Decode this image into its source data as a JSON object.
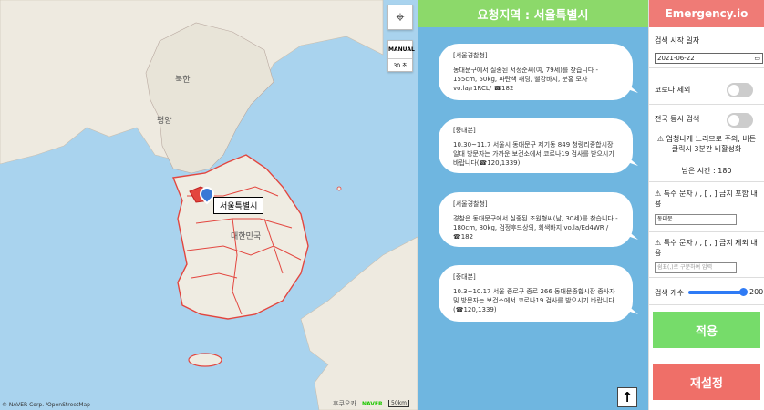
{
  "map": {
    "manual_label": "MANUAL",
    "timer_label": "30 초",
    "places": [
      {
        "name": "북한",
        "id": "north-korea"
      },
      {
        "name": "평양",
        "id": "pyongyang"
      },
      {
        "name": "대한민국",
        "id": "south-korea"
      },
      {
        "name": "후쿠오카",
        "id": "fukuoka"
      }
    ],
    "selected_region": "서울특별시",
    "copyright": "© NAVER Corp. /OpenStreetMap",
    "logo": "NAVER",
    "scale": "50km",
    "border_color": "#e3463f"
  },
  "feed": {
    "title": "요청지역 : 서울특별시",
    "messages": [
      {
        "source": "[서울경찰청]",
        "text": "동대문구에서 실종된 서정순씨(여, 79세)를 찾습니다 - 155cm, 50kg, 파란색 패딩, 빨강바지, 분홍 모자 vo.la/r1RCL/ ☎182"
      },
      {
        "source": "[중대본]",
        "text": "10.30~11.7 서울시 동대문구 제기동 849 청량리종합시장 일대 방문자는 가까운 보건소에서 코로나19 검사를 받으시기 바랍니다(☎120,1339)"
      },
      {
        "source": "[서울경찰청]",
        "text": "경찰은 동대문구에서 실종된 조원형씨(남, 30세)를 찾습니다 - 180cm, 80kg, 검정후드상의, 회색바지 vo.la/Ed4WR / ☎182"
      },
      {
        "source": "[중대본]",
        "text": "10.3~10.17 서울 종로구 종로 266 동대문종합시장 종사자 및 방문자는 보건소에서 코로나19 검사를 받으시기 바랍니다(☎120,1339)"
      }
    ],
    "up_icon": "up-arrow-icon"
  },
  "panel": {
    "title": "Emergency.io",
    "start_date_label": "검색 시작 일자",
    "start_date_value": "2021-06-22",
    "corona_exclude_label": "코로나 제외",
    "corona_exclude_on": false,
    "nationwide_label": "전국 동시 검색",
    "nationwide_on": false,
    "warning": "⚠ 엄청나게 느리므로 주의, 버튼 클릭시 3분간 비활성화",
    "remaining": "남은 시간 : 180",
    "include_label": "⚠ 특수 문자 / , [ , ] 금지 포함 내용",
    "include_value": "동대문",
    "exclude_label": "⚠ 특수 문자 / , [ , ] 금지 제외 내용",
    "exclude_placeholder": "쉼표(,)로 구분하여 입력",
    "count_label": "검색 개수",
    "count_value": "200",
    "apply_label": "적용",
    "reset_label": "재설정",
    "apply_color": "#76dc6a",
    "reset_color": "#ef6f68"
  }
}
